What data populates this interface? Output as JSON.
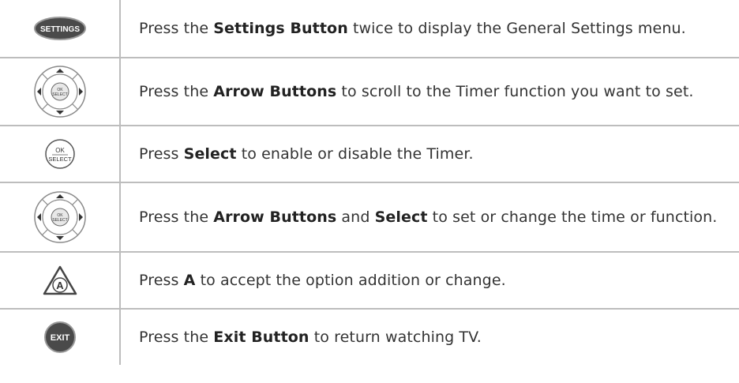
{
  "steps": [
    {
      "icon": "settings-button-icon",
      "icon_text": "SETTINGS",
      "parts": [
        {
          "t": "Press the ",
          "b": false
        },
        {
          "t": "Settings Button",
          "b": true
        },
        {
          "t": " twice to display the General Settings menu.",
          "b": false
        }
      ]
    },
    {
      "icon": "arrow-pad-icon",
      "icon_text": "OK SELECT",
      "parts": [
        {
          "t": "Press the ",
          "b": false
        },
        {
          "t": "Arrow Buttons",
          "b": true
        },
        {
          "t": " to scroll to the Timer function you want to set.",
          "b": false
        }
      ]
    },
    {
      "icon": "ok-select-button-icon",
      "icon_text": "OK SELECT",
      "parts": [
        {
          "t": "Press ",
          "b": false
        },
        {
          "t": "Select",
          "b": true
        },
        {
          "t": " to enable or disable the Timer.",
          "b": false
        }
      ]
    },
    {
      "icon": "arrow-pad-icon",
      "icon_text": "OK SELECT",
      "parts": [
        {
          "t": "Press the ",
          "b": false
        },
        {
          "t": "Arrow Buttons",
          "b": true
        },
        {
          "t": " and ",
          "b": false
        },
        {
          "t": "Select",
          "b": true
        },
        {
          "t": " to set or change the time or function.",
          "b": false
        }
      ]
    },
    {
      "icon": "a-button-icon",
      "icon_text": "A",
      "parts": [
        {
          "t": "Press ",
          "b": false
        },
        {
          "t": "A",
          "b": true
        },
        {
          "t": " to accept the option addition or change.",
          "b": false
        }
      ]
    },
    {
      "icon": "exit-button-icon",
      "icon_text": "EXIT",
      "parts": [
        {
          "t": "Press the ",
          "b": false
        },
        {
          "t": "Exit Button",
          "b": true
        },
        {
          "t": " to return watching TV.",
          "b": false
        }
      ]
    }
  ]
}
